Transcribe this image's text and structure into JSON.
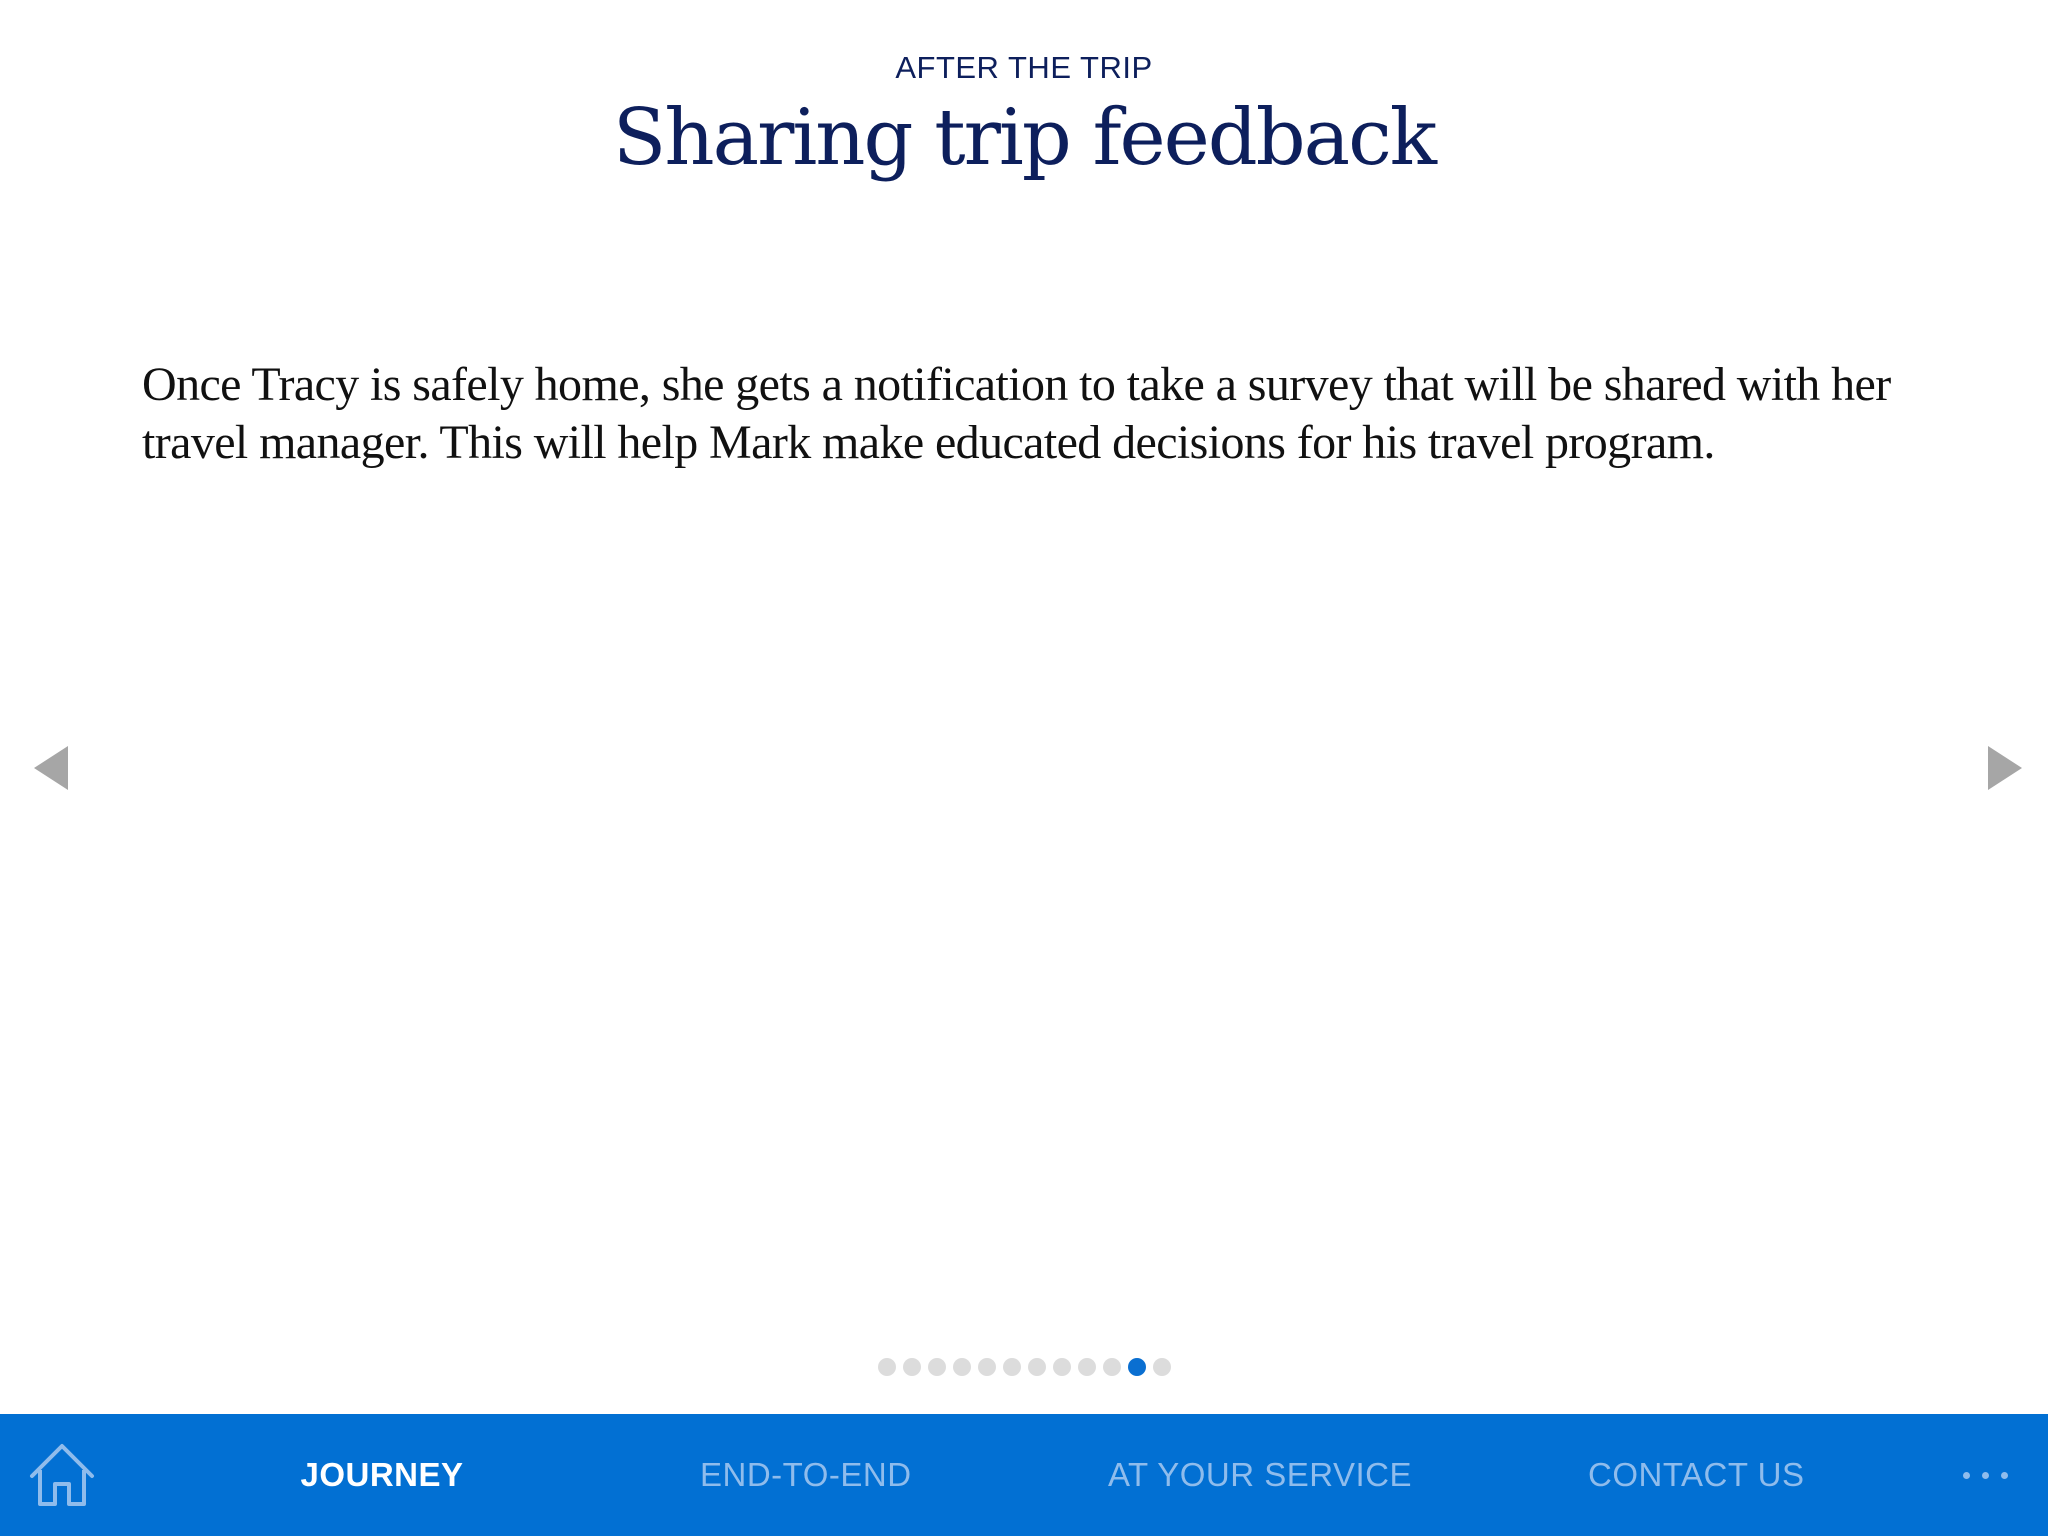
{
  "header": {
    "eyebrow": "AFTER THE TRIP",
    "title": "Sharing trip feedback"
  },
  "body": {
    "paragraph": "Once Tracy is safely home, she gets a notification to take a survey that will be shared with her travel manager. This will help Mark make educated decisions for his travel program."
  },
  "navigation": {
    "prev_icon": "triangle-left-icon",
    "next_icon": "triangle-right-icon"
  },
  "pager": {
    "total": 12,
    "active_index": 10
  },
  "tabbar": {
    "home_icon": "home-icon",
    "items": [
      {
        "label": "JOURNEY",
        "active": true
      },
      {
        "label": "END-TO-END",
        "active": false
      },
      {
        "label": "AT YOUR SERVICE",
        "active": false
      },
      {
        "label": "CONTACT US",
        "active": false
      }
    ],
    "more_icon": "more-dots-icon"
  },
  "colors": {
    "title": "#0d1f5c",
    "tabbar_bg": "#0270d3",
    "tab_inactive": "#8fbcec",
    "tab_active": "#ffffff",
    "dot_active": "#0a6fd1",
    "dot_inactive": "#dcdcdc",
    "arrow": "#a6a6a6"
  }
}
